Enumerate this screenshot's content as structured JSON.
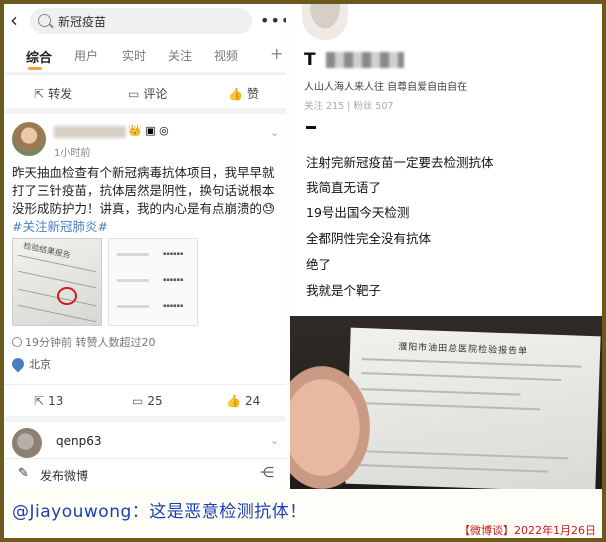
{
  "search": {
    "query": "新冠疫苗"
  },
  "tabs": [
    {
      "label": "综合"
    },
    {
      "label": "用户"
    },
    {
      "label": "实时"
    },
    {
      "label": "关注"
    },
    {
      "label": "视频"
    }
  ],
  "top_actions": {
    "repost": "转发",
    "comment": "评论",
    "like": "赞"
  },
  "post": {
    "time": "1小时前",
    "text": "昨天抽血检查有个新冠病毒抗体项目，我早早就打了三针疫苗，抗体居然是阴性，换句话说根本没形成防护力！讲真，我的内心是有点崩溃的",
    "hashtag": "#关注新冠肺炎#",
    "thumb_title": "检验结果报告",
    "meta": "19分钟前 转赞人数超过20",
    "location": "北京",
    "reposts": "13",
    "comments": "25",
    "likes": "24"
  },
  "post2": {
    "username": "qenp63"
  },
  "bottom": {
    "compose": "发布微博"
  },
  "right": {
    "name_first_char": "T",
    "bio": "人山人海人来人往 自尊自爱自由自在",
    "stats": "关注 215 | 粉丝 507",
    "lines": [
      "注射完新冠疫苗一定要去检测抗体",
      "我简直无语了",
      "19号出国今天检测",
      "全都阴性完全没有抗体",
      "绝了",
      "我就是个靶子"
    ],
    "report_title": "濮阳市油田总医院检验报告单"
  },
  "caption": {
    "main": "@Jiayouwong：这是恶意检测抗体！",
    "source": "【微博谈】2022年1月26日"
  },
  "colors": {
    "frame": "#6b5a1e",
    "caption_text": "#1a3fb4",
    "source_text": "#c01d1d",
    "tab_accent": "#f7a03c",
    "hashtag": "#4a7fc4"
  }
}
